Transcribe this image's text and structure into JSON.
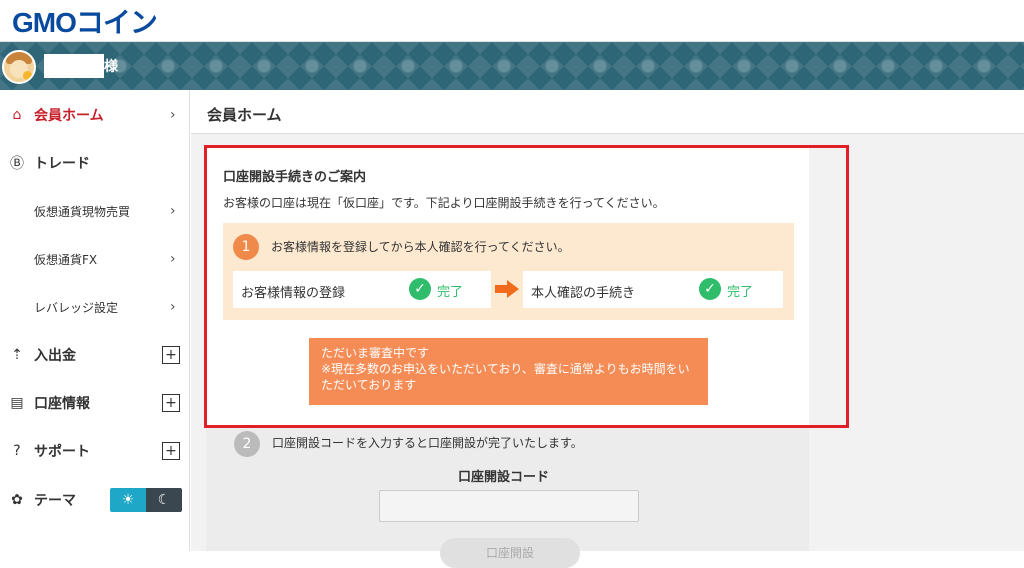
{
  "brand": {
    "logo": "GMOコイン"
  },
  "user": {
    "suffix": "様"
  },
  "sidebar": {
    "items": [
      {
        "label": "会員ホーム",
        "icon": "home-icon",
        "active": true
      },
      {
        "label": "トレード",
        "icon": "bitcoin-icon"
      },
      {
        "label": "仮想通貨現物売買"
      },
      {
        "label": "仮想通貨FX"
      },
      {
        "label": "レバレッジ設定"
      },
      {
        "label": "入出金",
        "icon": "deposit-icon"
      },
      {
        "label": "口座情報",
        "icon": "card-icon"
      },
      {
        "label": "サポート",
        "icon": "help-icon"
      },
      {
        "label": "テーマ",
        "icon": "palette-icon"
      }
    ]
  },
  "page": {
    "title": "会員ホーム"
  },
  "guide": {
    "title": "口座開設手続きのご案内",
    "description": "お客様の口座は現在「仮口座」です。下記より口座開設手続きを行ってください。",
    "step1": {
      "number": "1",
      "text": "お客様情報を登録してから本人確認を行ってください。",
      "box1_label": "お客様情報の登録",
      "box1_status": "完了",
      "box2_label": "本人確認の手続き",
      "box2_status": "完了"
    },
    "notice": {
      "line1": "ただいま審査中です",
      "line2": "※現在多数のお申込をいただいており、審査に通常よりもお時間をいただいております"
    },
    "step2": {
      "number": "2",
      "text": "口座開設コードを入力すると口座開設が完了いたします。",
      "code_label": "口座開設コード",
      "button_label": "口座開設"
    }
  },
  "colors": {
    "accent_red": "#c8202a",
    "success": "#2fbd6b",
    "notice": "#f58c55"
  }
}
